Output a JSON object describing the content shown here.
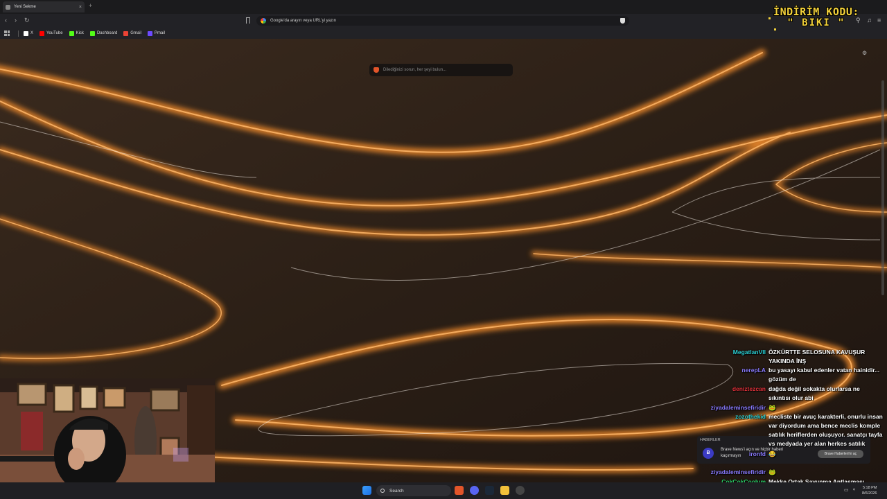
{
  "browser": {
    "tab_title": "Yeni Sekme",
    "close_glyph": "×",
    "new_tab_glyph": "+",
    "url_placeholder": "Google'da arayın veya URL'yi yazın",
    "bookmarks": [
      {
        "label": "X",
        "icon": "x-icon",
        "color": "#ffffff"
      },
      {
        "label": "YouTube",
        "icon": "youtube-icon",
        "color": "#ff0000"
      },
      {
        "label": "Kick",
        "icon": "kick-icon",
        "color": "#53fc18"
      },
      {
        "label": "Dashboard",
        "icon": "kick-icon",
        "color": "#53fc18"
      },
      {
        "label": "Gmail",
        "icon": "gmail-icon",
        "color": "#ea4335"
      },
      {
        "label": "Pmail",
        "icon": "proton-mail-icon",
        "color": "#6d4aff"
      }
    ]
  },
  "newtab": {
    "search_placeholder": "Dilediğinizi sorun, her şeyi bulun..."
  },
  "promo": {
    "line1": "İNDİRİM KODU:",
    "line2": "\" BIKI \"",
    "color": "#f2d13a"
  },
  "chat": [
    {
      "user": "MegatlanVII",
      "color": "#2bd1d6",
      "text": "ÖZKÜRTTE SELOSUNA KAVUŞUR YAKINDA İNŞ"
    },
    {
      "user": "nerepLA",
      "color": "#8a7bff",
      "text": "bu yasayı kabul edenler vatan hainidir... gözüm de"
    },
    {
      "user": "deniztezcan",
      "color": "#e0323a",
      "text": "dağda değil sokakta olurlarsa ne sıkıntısı olur abi"
    },
    {
      "user": "ziyadaleminsefiridir",
      "color": "#8a7bff",
      "text": "🐸"
    },
    {
      "user": "zozothekid",
      "color": "#2bd1d6",
      "text": "mecliste bir avuç karakterli, onurlu insan var diyordum ama bence meclis komple satılık heriflerden oluşuyor. sanatçı tayfa vs medyada yer alan herkes satılık"
    },
    {
      "user": "ironfd",
      "color": "#8a7bff",
      "text": "😂"
    },
    {
      "user": "ziyadaleminsefiridir",
      "color": "#8a7bff",
      "text": "🐸"
    },
    {
      "user": "CokCokCoolum",
      "color": "#2bd16a",
      "text": "Mekke Ortak Savunma Antlaşması konuşulacak değil mi"
    }
  ],
  "news": {
    "header": "HABERLER",
    "body": "Brave News'i açın ve hiçbir haberi kaçırmayın",
    "button": "Brave Haberleri'ni aç",
    "badge": "B"
  },
  "taskbar": {
    "search_label": "Search",
    "time": "5:18 PM",
    "date": "8/6/2026"
  }
}
